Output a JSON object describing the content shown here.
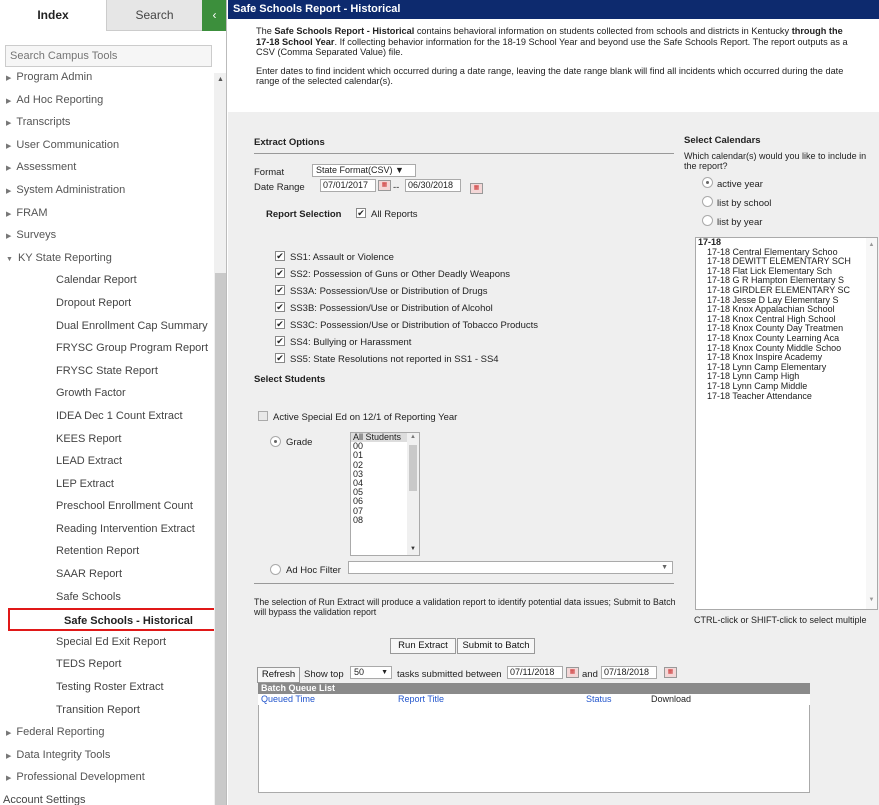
{
  "sidebar": {
    "tabs": {
      "index": "Index",
      "search": "Search",
      "collapse": "‹"
    },
    "search_placeholder": "Search Campus Tools",
    "top_items": [
      {
        "label": "Program Admin"
      },
      {
        "label": "Ad Hoc Reporting"
      },
      {
        "label": "Transcripts"
      },
      {
        "label": "User Communication"
      },
      {
        "label": "Assessment"
      },
      {
        "label": "System Administration"
      },
      {
        "label": "FRAM"
      },
      {
        "label": "Surveys"
      },
      {
        "label": "KY State Reporting"
      }
    ],
    "sub_items": [
      {
        "label": "Calendar Report"
      },
      {
        "label": "Dropout Report"
      },
      {
        "label": "Dual Enrollment Cap Summary"
      },
      {
        "label": "FRYSC Group Program Report"
      },
      {
        "label": "FRYSC State Report"
      },
      {
        "label": "Growth Factor"
      },
      {
        "label": "IDEA Dec 1 Count Extract"
      },
      {
        "label": "KEES Report"
      },
      {
        "label": "LEAD Extract"
      },
      {
        "label": "LEP Extract"
      },
      {
        "label": "Preschool Enrollment Count"
      },
      {
        "label": "Reading Intervention Extract"
      },
      {
        "label": "Retention Report"
      },
      {
        "label": "SAAR Report"
      },
      {
        "label": "Safe Schools"
      },
      {
        "label": "Safe Schools - Historical"
      },
      {
        "label": "Special Ed Exit Report"
      },
      {
        "label": "TEDS Report"
      },
      {
        "label": "Testing Roster Extract"
      },
      {
        "label": "Transition Report"
      }
    ],
    "bottom_items": [
      {
        "label": "Federal Reporting"
      },
      {
        "label": "Data Integrity Tools"
      },
      {
        "label": "Professional Development"
      }
    ],
    "account_settings": "Account Settings"
  },
  "main": {
    "title": "Safe Schools Report - Historical",
    "intro": {
      "p1_a": "The ",
      "p1_b": "Safe Schools Report - Historical",
      "p1_c": " contains behavioral information on students collected from schools and districts in Kentucky ",
      "p1_d": "through the 17-18 School Year",
      "p1_e": ". If collecting behavior information for the 18-19 School Year and beyond use the Safe Schools Report. The report outputs as a CSV (Comma Separated Value) file.",
      "p2": "Enter dates to find incident which occurred during a date range, leaving the date range blank will find all incidents which occurred during the date range of the selected calendar(s)."
    },
    "extract_options": {
      "heading": "Extract Options",
      "format_label": "Format",
      "format_value": "State Format(CSV) ▼",
      "date_range_label": "Date Range",
      "date_from": "07/01/2017",
      "date_sep": "--",
      "date_to": "06/30/2018",
      "report_selection_label": "Report Selection",
      "all_reports_label": "All Reports",
      "reports": [
        {
          "label": "SS1: Assault or Violence"
        },
        {
          "label": "SS2: Possession of Guns or Other Deadly Weapons"
        },
        {
          "label": "SS3A: Possession/Use or Distribution of Drugs"
        },
        {
          "label": "SS3B: Possession/Use or Distribution of Alcohol"
        },
        {
          "label": "SS3C: Possession/Use or Distribution of Tobacco Products"
        },
        {
          "label": "SS4: Bullying or Harassment"
        },
        {
          "label": "SS5: State Resolutions not reported in SS1 - SS4"
        }
      ]
    },
    "select_students": {
      "heading": "Select Students",
      "special_ed_label": "Active Special Ed on 12/1 of Reporting Year",
      "grade_label": "Grade",
      "grades": [
        "All Students",
        "00",
        "01",
        "02",
        "03",
        "04",
        "05",
        "06",
        "07",
        "08"
      ],
      "adhoc_label": "Ad Hoc Filter"
    },
    "validation_note": "The selection of Run Extract will produce a validation report to identify potential data issues; Submit to Batch will bypass the validation report",
    "run_extract": "Run Extract",
    "submit_batch": "Submit to Batch",
    "refresh": "Refresh",
    "show_top_label": "Show top",
    "show_top_value": "50",
    "between_label": "tasks submitted between",
    "batch_from": "07/11/2018",
    "and_label": "and",
    "batch_to": "07/18/2018",
    "batch_queue": {
      "title": "Batch Queue List",
      "columns": [
        "Queued Time",
        "Report Title",
        "Status",
        "Download"
      ]
    },
    "calendars": {
      "heading": "Select Calendars",
      "question": "Which calendar(s) would you like to include in the report?",
      "options": [
        "active year",
        "list by school",
        "list by year"
      ],
      "year": "17-18",
      "schools": [
        "17-18 Central Elementary Schoo",
        "17-18 DEWITT ELEMENTARY SCH",
        "17-18 Flat Lick Elementary Sch",
        "17-18 G R Hampton Elementary S",
        "17-18 GIRDLER ELEMENTARY SC",
        "17-18 Jesse D Lay Elementary S",
        "17-18 Knox Appalachian School",
        "17-18 Knox Central High School",
        "17-18 Knox County Day Treatmen",
        "17-18 Knox County Learning Aca",
        "17-18 Knox County Middle Schoo",
        "17-18 Knox Inspire Academy",
        "17-18 Lynn Camp Elementary",
        "17-18 Lynn Camp High",
        "17-18 Lynn Camp Middle",
        "17-18 Teacher Attendance"
      ],
      "hint": "CTRL-click or SHIFT-click to select multiple"
    }
  }
}
